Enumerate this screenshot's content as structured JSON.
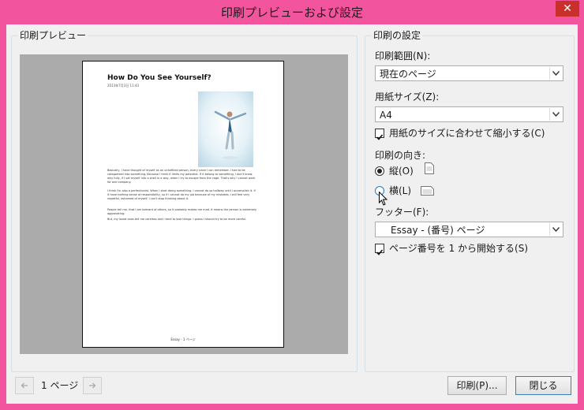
{
  "window": {
    "title": "印刷プレビューおよび設定",
    "close_glyph": "✕"
  },
  "preview": {
    "group_label": "印刷プレビュー",
    "doc": {
      "title": "How Do You See Yourself?",
      "date": "2013年7月3日        11:43",
      "paragraphs": [
        "Basically, I have thought of myself as an unfulfilled person, every since I can remember. I had to be categorized into something. Because I think it limits my potential. If it belong to something, I don't know, why fully, if I set myself into a shell in a way, when I try to escape from the cage. That's why I cannot work for one company.",
        "I think I'm also a perfectionist. When I start doing something, I cannot do so halfway until I accomplish it. If it have nothing sense of responsibility, so if I cannot do my job because of my mistakes, I will feel very regretful, ashamed of myself. I can't stop thinking about it.",
        "People tell me, that I am tolerant of others, so it probably makes me mad, it means the person is extremely aggravating.",
        "But, my loved ones tell me careless and I tend to lose things. I guess I should try to be more careful."
      ],
      "footer": "Essay - 1 ページ"
    }
  },
  "settings": {
    "group_label": "印刷の設定",
    "range_label": "印刷範囲(N):",
    "range_value": "現在のページ",
    "paper_label": "用紙サイズ(Z):",
    "paper_value": "A4",
    "fit_label": "用紙のサイズに合わせて縮小する(C)",
    "fit_checked": true,
    "orientation_label": "印刷の向き:",
    "portrait_label": "縦(O)",
    "landscape_label": "横(L)",
    "selected_orientation": "portrait",
    "footer_label": "フッター(F):",
    "footer_value": "Essay - (番号) ページ",
    "startone_label": "ページ番号を 1 から開始する(S)",
    "startone_checked": true
  },
  "nav": {
    "page_text": "1 ページ"
  },
  "buttons": {
    "print": "印刷(P)...",
    "close": "閉じる"
  },
  "colors": {
    "window_frame": "#f2559e",
    "close_button": "#c9302c",
    "dialog_bg": "#f0f0f0"
  }
}
